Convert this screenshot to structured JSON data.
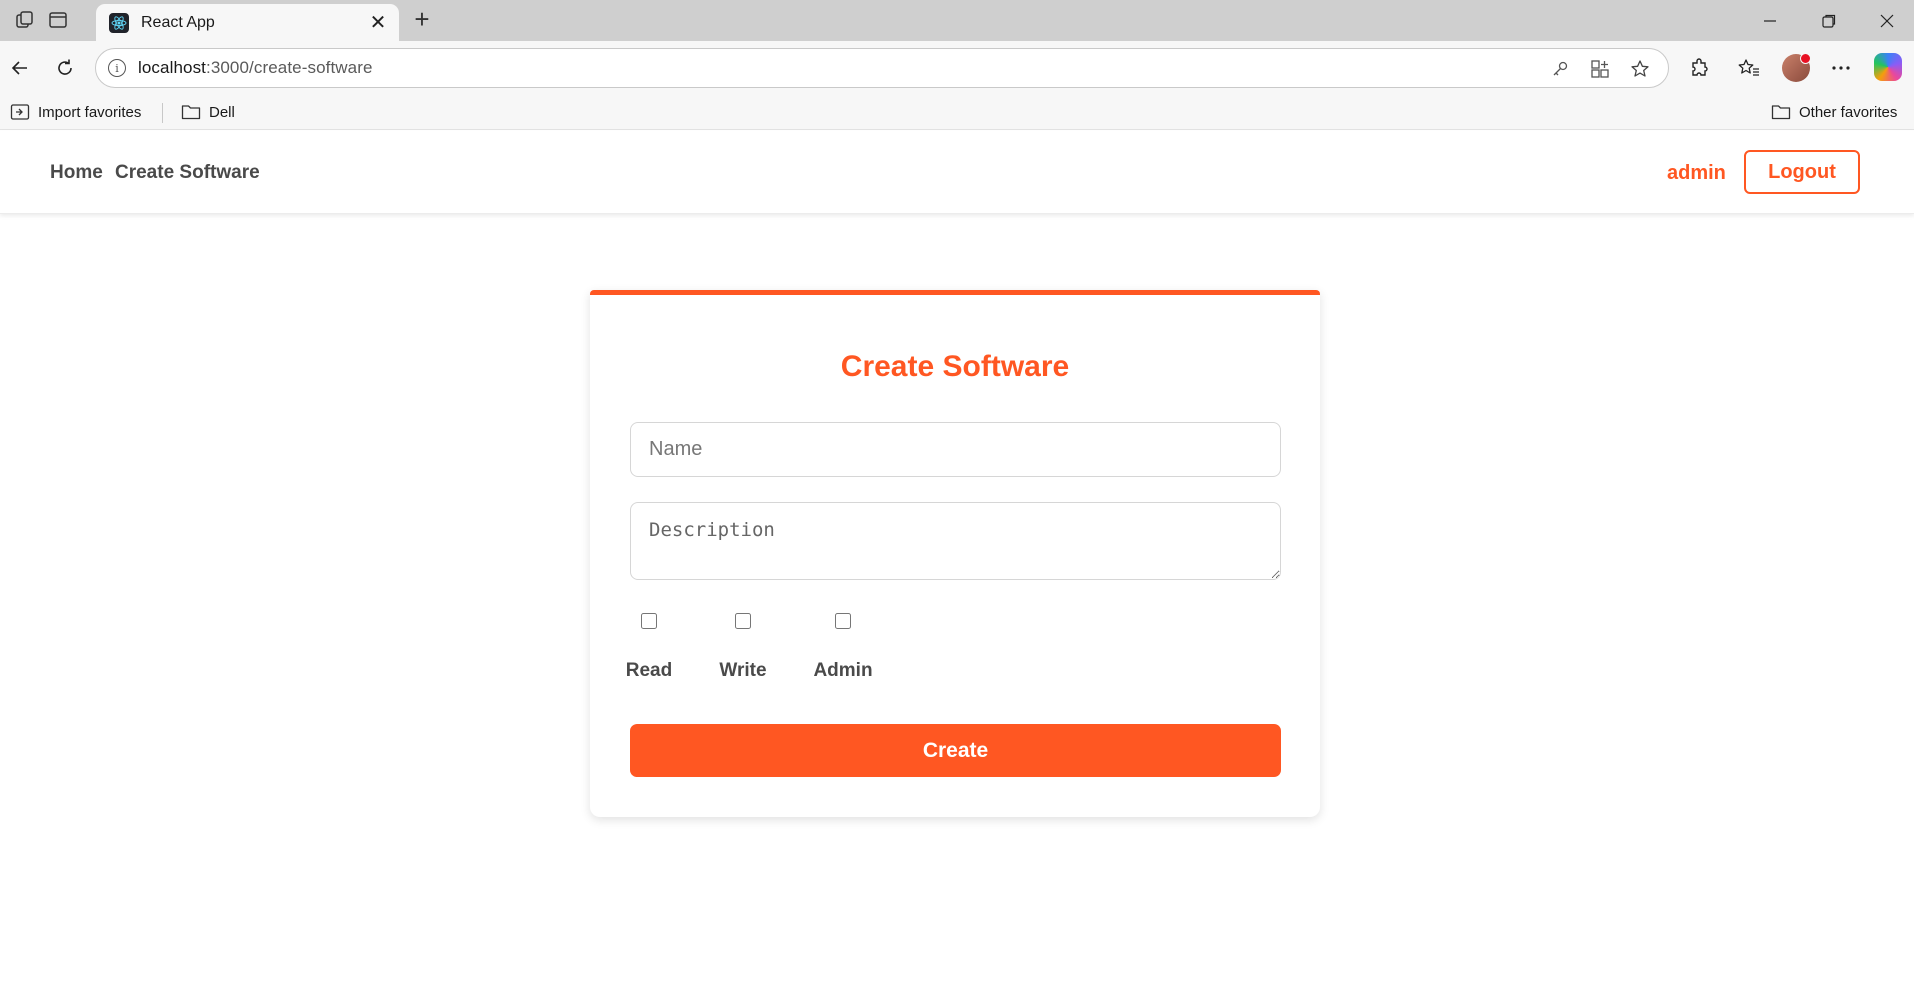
{
  "browser": {
    "tab_title": "React App",
    "url_host": "localhost",
    "url_path": ":3000/create-software",
    "favorites": {
      "import_label": "Import favorites",
      "dell_label": "Dell",
      "other_label": "Other favorites"
    }
  },
  "header": {
    "nav": [
      "Home",
      "Create Software"
    ],
    "user": "admin",
    "logout_label": "Logout"
  },
  "form": {
    "title": "Create Software",
    "name_placeholder": "Name",
    "name_value": "",
    "description_placeholder": "Description",
    "description_value": "",
    "permissions": [
      {
        "label": "Read",
        "checked": false
      },
      {
        "label": "Write",
        "checked": false
      },
      {
        "label": "Admin",
        "checked": false
      }
    ],
    "submit_label": "Create"
  },
  "colors": {
    "accent": "#ff5722",
    "nav_text": "#4a4a4a"
  }
}
